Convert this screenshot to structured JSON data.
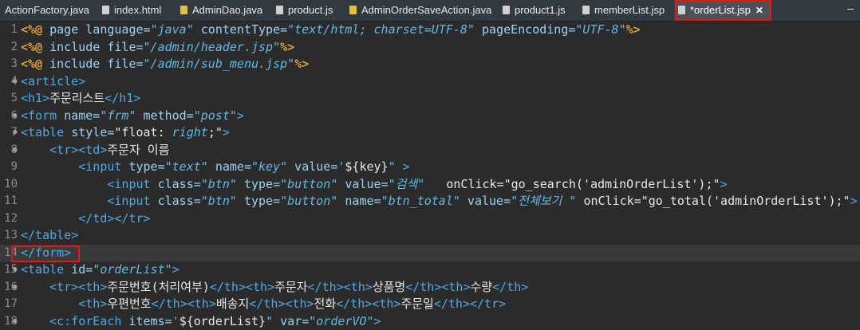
{
  "tabs": [
    {
      "label": "ActionFactory.java",
      "icon": "java-file-icon",
      "color": "#c7b74a"
    },
    {
      "label": "index.html",
      "icon": "html-file-icon",
      "color": "#d0d0d0"
    },
    {
      "label": "AdminDao.java",
      "icon": "java-file-icon",
      "color": "#e0c040"
    },
    {
      "label": "product.js",
      "icon": "js-file-icon",
      "color": "#d0d0d0"
    },
    {
      "label": "AdminOrderSaveAction.java",
      "icon": "java-file-icon",
      "color": "#e0c040"
    },
    {
      "label": "product1.js",
      "icon": "js-file-icon",
      "color": "#d0d0d0"
    },
    {
      "label": "memberList.jsp",
      "icon": "jsp-file-icon",
      "color": "#d0d0d0"
    },
    {
      "label": "*orderList.jsp",
      "icon": "jsp-file-icon",
      "color": "#d0d0d0",
      "active": true,
      "close": "✕"
    }
  ],
  "minimize": "‒",
  "lines": [
    {
      "n": "1",
      "parts": [
        [
          "dir",
          "<%@ "
        ],
        [
          "attr",
          "page language="
        ],
        [
          "str",
          "\"java\""
        ],
        [
          "attr",
          " contentType="
        ],
        [
          "str",
          "\"text/html; charset=UTF-8\""
        ],
        [
          "attr",
          " pageEncoding="
        ],
        [
          "str",
          "\"UTF-8\""
        ],
        [
          "dir",
          "%>"
        ]
      ]
    },
    {
      "n": "2",
      "parts": [
        [
          "dir",
          "<%@ "
        ],
        [
          "attr",
          "include file="
        ],
        [
          "str",
          "\"/admin/header.jsp\""
        ],
        [
          "dir",
          "%>"
        ]
      ]
    },
    {
      "n": "3",
      "parts": [
        [
          "dir",
          "<%@ "
        ],
        [
          "attr",
          "include file="
        ],
        [
          "str",
          "\"/admin/sub_menu.jsp\""
        ],
        [
          "dir",
          "%>"
        ]
      ]
    },
    {
      "n": "4",
      "fold": true,
      "parts": [
        [
          "tag",
          "<article>"
        ]
      ]
    },
    {
      "n": "5",
      "parts": [
        [
          "tag",
          "<h1>"
        ],
        [
          "txt",
          "주문리스트"
        ],
        [
          "tag",
          "</h1>"
        ]
      ]
    },
    {
      "n": "6",
      "fold": true,
      "parts": [
        [
          "tag",
          "<form "
        ],
        [
          "attr",
          "name="
        ],
        [
          "str",
          "\"frm\""
        ],
        [
          "attr",
          " method="
        ],
        [
          "str",
          "\"post\""
        ],
        [
          "tag",
          ">"
        ]
      ]
    },
    {
      "n": "7",
      "fold": true,
      "parts": [
        [
          "tag",
          "<table "
        ],
        [
          "attr",
          "style="
        ],
        [
          "txt",
          "\"float: "
        ],
        [
          "str",
          "right"
        ],
        [
          "txt",
          ";\""
        ],
        [
          "tag",
          ">"
        ]
      ]
    },
    {
      "n": "8",
      "fold": true,
      "parts": [
        [
          "txt",
          "    "
        ],
        [
          "tag",
          "<tr><td>"
        ],
        [
          "txt",
          "주문자 이름"
        ]
      ]
    },
    {
      "n": "9",
      "parts": [
        [
          "txt",
          "        "
        ],
        [
          "tag",
          "<input "
        ],
        [
          "attr",
          "type="
        ],
        [
          "str",
          "\"text\""
        ],
        [
          "attr",
          " name="
        ],
        [
          "str",
          "\"key\""
        ],
        [
          "attr",
          " value="
        ],
        [
          "str",
          "'"
        ],
        [
          "txt",
          "${key}"
        ],
        [
          "str",
          "\" "
        ],
        [
          "tag",
          ">"
        ]
      ]
    },
    {
      "n": "10",
      "parts": [
        [
          "txt",
          "            "
        ],
        [
          "tag",
          "<input "
        ],
        [
          "attr",
          "class="
        ],
        [
          "str",
          "\"btn\""
        ],
        [
          "attr",
          " type="
        ],
        [
          "str",
          "\"button\""
        ],
        [
          "attr",
          " value="
        ],
        [
          "str",
          "\"검색\""
        ],
        [
          "txt",
          "   onClick=\"go_search('adminOrderList');\""
        ],
        [
          "tag",
          ">"
        ]
      ]
    },
    {
      "n": "11",
      "parts": [
        [
          "txt",
          "            "
        ],
        [
          "tag",
          "<input "
        ],
        [
          "attr",
          "class="
        ],
        [
          "str",
          "\"btn\""
        ],
        [
          "attr",
          " type="
        ],
        [
          "str",
          "\"button\""
        ],
        [
          "attr",
          " name="
        ],
        [
          "str",
          "\"btn_total\""
        ],
        [
          "attr",
          " value="
        ],
        [
          "str",
          "\"전체보기 \""
        ],
        [
          "txt",
          " onClick=\"go_total('adminOrderList');\""
        ],
        [
          "tag",
          ">"
        ]
      ]
    },
    {
      "n": "12",
      "parts": [
        [
          "txt",
          "        "
        ],
        [
          "tag",
          "</td></tr>"
        ]
      ]
    },
    {
      "n": "13",
      "parts": [
        [
          "tag",
          "</table>"
        ]
      ]
    },
    {
      "n": "14",
      "cur": true,
      "parts": [
        [
          "tag",
          "</form>"
        ]
      ]
    },
    {
      "n": "15",
      "fold": true,
      "parts": [
        [
          "tag",
          "<table "
        ],
        [
          "attr",
          "id="
        ],
        [
          "str",
          "\"orderList\""
        ],
        [
          "tag",
          ">"
        ]
      ]
    },
    {
      "n": "16",
      "fold": true,
      "parts": [
        [
          "txt",
          "    "
        ],
        [
          "tag",
          "<tr><th>"
        ],
        [
          "txt",
          "주문번호(처리여부)"
        ],
        [
          "tag",
          "</th><th>"
        ],
        [
          "txt",
          "주문자"
        ],
        [
          "tag",
          "</th><th>"
        ],
        [
          "txt",
          "상품명"
        ],
        [
          "tag",
          "</th><th>"
        ],
        [
          "txt",
          "수량"
        ],
        [
          "tag",
          "</th>"
        ]
      ]
    },
    {
      "n": "17",
      "parts": [
        [
          "txt",
          "        "
        ],
        [
          "tag",
          "<th>"
        ],
        [
          "txt",
          "우편번호"
        ],
        [
          "tag",
          "</th><th>"
        ],
        [
          "txt",
          "배송지"
        ],
        [
          "tag",
          "</th><th>"
        ],
        [
          "txt",
          "전화"
        ],
        [
          "tag",
          "</th><th>"
        ],
        [
          "txt",
          "주문일"
        ],
        [
          "tag",
          "</th></tr>"
        ]
      ]
    },
    {
      "n": "18",
      "fold": true,
      "parts": [
        [
          "txt",
          "    "
        ],
        [
          "tag",
          "<c:forEach "
        ],
        [
          "attr",
          "items="
        ],
        [
          "str",
          "'"
        ],
        [
          "txt",
          "${orderList}"
        ],
        [
          "str",
          "\""
        ],
        [
          "attr",
          " var="
        ],
        [
          "str",
          "\"orderVO\""
        ],
        [
          "tag",
          ">"
        ]
      ]
    }
  ]
}
